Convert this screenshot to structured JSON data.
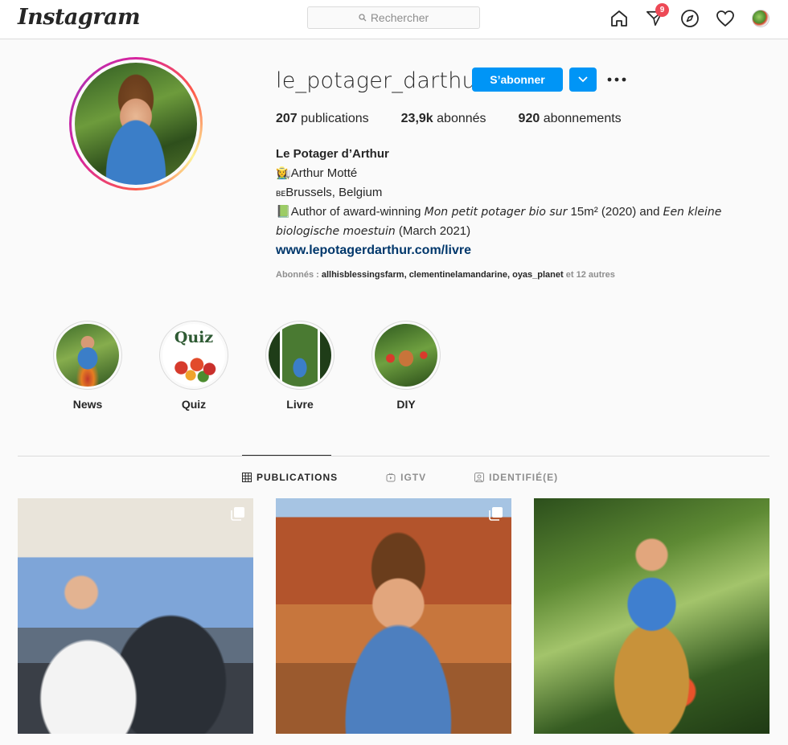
{
  "app": {
    "logo_text": "Instagram"
  },
  "search": {
    "placeholder": "Rechercher"
  },
  "nav": {
    "activity_badge": "9",
    "icons": [
      "home-icon",
      "direct-icon",
      "explore-icon",
      "heart-icon",
      "avatar"
    ]
  },
  "profile": {
    "username": "le_potager_darthur",
    "follow_label": "S’abonner",
    "stats": {
      "posts_count": "207",
      "posts_label": "publications",
      "followers_count": "23,9k",
      "followers_label": "abonnés",
      "following_count": "920",
      "following_label": "abonnements"
    },
    "bio": {
      "name": "Le Potager d’Arthur",
      "line1_emoji": "👩‍🌾",
      "line1": "Arthur Motté",
      "line2_flag": "ʙᴇ",
      "line2": "Brussels, Belgium",
      "line3_emoji": "📗",
      "line3_a": "Author of award-winning ",
      "line3_b": "Mon petit potager bio sur",
      "line3_c": " 15m² (2020) and ",
      "line3_d": "Een kleine biologische moestuin",
      "line3_e": " (March 2021)",
      "link": "www.lepotagerdarthur.com/livre"
    },
    "followed_by": {
      "prefix": "Abonnés : ",
      "accounts": [
        "allhisblessingsfarm",
        "clementinelamandarine",
        "oyas_planet"
      ],
      "suffix": " et 12 autres"
    }
  },
  "highlights": [
    {
      "label": "News"
    },
    {
      "label": "Quiz",
      "cover_text": "Quiz"
    },
    {
      "label": "Livre"
    },
    {
      "label": "DIY"
    }
  ],
  "tabs": [
    {
      "label": "PUBLICATIONS",
      "active": true
    },
    {
      "label": "IGTV",
      "active": false
    },
    {
      "label": "IDENTIFIÉ(E)",
      "active": false
    }
  ],
  "colors": {
    "primary": "#0095f6",
    "badge": "#ed4956",
    "link": "#00376b"
  }
}
